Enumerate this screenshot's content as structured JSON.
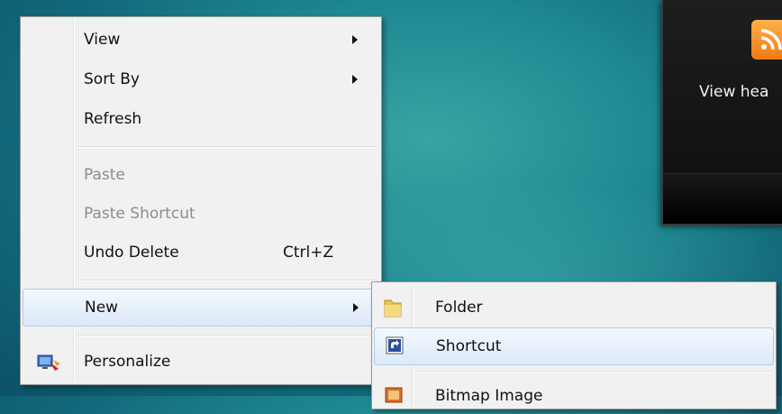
{
  "gadget": {
    "icon": "rss-feed-icon",
    "text": "View hea"
  },
  "context_menu": {
    "items": [
      {
        "label": "View",
        "submenu": true,
        "enabled": true
      },
      {
        "label": "Sort By",
        "submenu": true,
        "enabled": true
      },
      {
        "label": "Refresh",
        "enabled": true
      },
      {
        "label": "Paste",
        "enabled": false
      },
      {
        "label": "Paste Shortcut",
        "enabled": false
      },
      {
        "label": "Undo Delete",
        "shortcut": "Ctrl+Z",
        "enabled": true
      },
      {
        "label": "New",
        "submenu": true,
        "enabled": true,
        "highlighted": true
      },
      {
        "label": "Personalize",
        "icon": "personalize-icon",
        "enabled": true
      }
    ]
  },
  "new_submenu": {
    "items": [
      {
        "label": "Folder",
        "icon": "folder-icon"
      },
      {
        "label": "Shortcut",
        "icon": "shortcut-icon",
        "highlighted": true
      },
      {
        "label": "Bitmap Image",
        "icon": "bitmap-image-icon"
      }
    ]
  },
  "colors": {
    "desktop": "#1f8a93",
    "menu_background": "#f1f1f1",
    "highlight": "#dce9f8",
    "disabled_text": "#8d8d8d"
  }
}
